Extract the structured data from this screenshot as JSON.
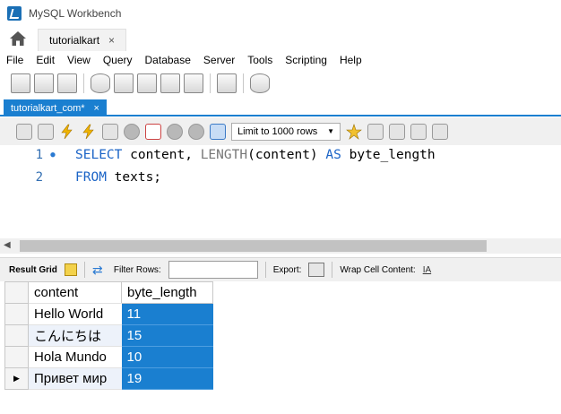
{
  "window": {
    "title": "MySQL Workbench"
  },
  "connection_tab": {
    "label": "tutorialkart",
    "close": "×"
  },
  "menu": [
    "File",
    "Edit",
    "View",
    "Query",
    "Database",
    "Server",
    "Tools",
    "Scripting",
    "Help"
  ],
  "query_tab": {
    "label": "tutorialkart_com*",
    "close": "×"
  },
  "editor_toolbar": {
    "limit_rows": "Limit to 1000 rows"
  },
  "editor": {
    "lines": [
      {
        "number": "1",
        "marker": "●"
      },
      {
        "number": "2",
        "marker": ""
      }
    ],
    "tokens": {
      "select": "SELECT",
      "part1": " content, ",
      "length_fn": "LENGTH",
      "part2": "(content) ",
      "as": "AS",
      "part3": " byte_length",
      "from": "FROM",
      "part4": " texts;"
    }
  },
  "result_toolbar": {
    "result_grid": "Result Grid",
    "filter_rows": "Filter Rows:",
    "filter_value": "",
    "export": "Export:",
    "wrap_cell": "Wrap Cell Content:",
    "wrap_glyph": "IA"
  },
  "result_grid": {
    "columns": [
      "content",
      "byte_length"
    ],
    "rows": [
      {
        "content": "Hello World",
        "byte_length": "11"
      },
      {
        "content": "こんにちは",
        "byte_length": "15"
      },
      {
        "content": "Hola Mundo",
        "byte_length": "10"
      },
      {
        "content": "Привет мир",
        "byte_length": "19"
      }
    ],
    "current_row_marker": "▶"
  },
  "colors": {
    "accent": "#1a7fd0",
    "keyword": "#1a63c6",
    "function": "#777777"
  }
}
